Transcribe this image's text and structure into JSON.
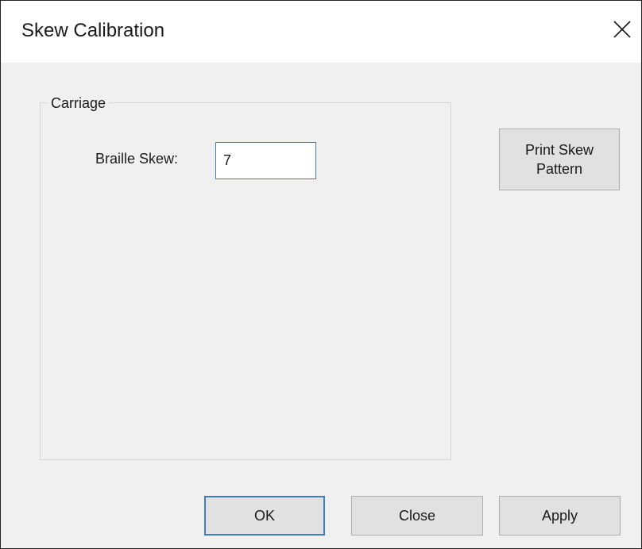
{
  "window": {
    "title": "Skew Calibration",
    "close_icon": "close-icon"
  },
  "carriage_group": {
    "label": "Carriage",
    "braille_skew": {
      "label": "Braille Skew:",
      "value": "7"
    }
  },
  "buttons": {
    "print_skew_pattern": "Print Skew Pattern",
    "ok": "OK",
    "close": "Close",
    "apply": "Apply"
  },
  "colors": {
    "focus_accent": "#3a7cc7",
    "dialog_background": "#f0f0f0",
    "button_face": "#e1e1e1"
  }
}
